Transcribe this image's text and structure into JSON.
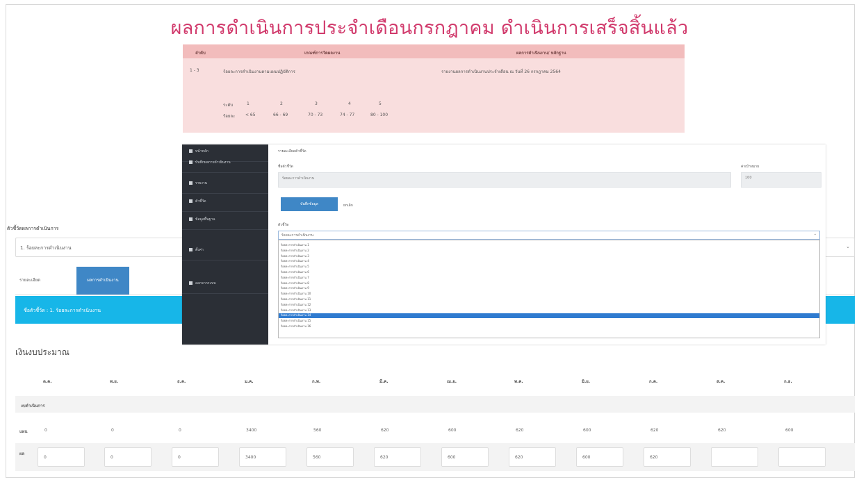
{
  "page_title": "ผลการดำเนินการประจำเดือนกรกฎาคม ดำเนินการเสร็จสิ้นแล้ว",
  "criteria_table": {
    "headers": [
      "ลำดับ",
      "เกณฑ์การวัดผลงาน",
      "ผลการดำเนินงาน/ หลักฐาน"
    ],
    "row_no": "1 - 3",
    "row_text": "ร้อยละการดำเนินงานตามแผนปฏิบัติการ",
    "scale_label": "ระดับ",
    "scale_levels": [
      "1",
      "2",
      "3",
      "4",
      "5"
    ],
    "score_label": "ร้อยละ",
    "score_ranges": [
      "< 65",
      "66 - 69",
      "70 - 73",
      "74 - 77",
      "80 - 100"
    ],
    "evidence": "รายงานผลการดำเนินงานประจำเดือน ณ วันที่ 26 กรกฎาคม 2564"
  },
  "inset": {
    "sidebar_items": [
      "หน้าหลัก",
      "บันทึกผลการดำเนินงาน",
      "รายงาน",
      "ตัวชี้วัด",
      "ข้อมูลพื้นฐาน",
      "ตั้งค่า",
      "ออกจากระบบ"
    ],
    "form_title": "รายละเอียดตัวชี้วัด",
    "field_name_label": "ชื่อตัวชี้วัด",
    "field_name_value": "ร้อยละการดำเนินงาน",
    "field_unit_label": "ค่าเป้าหมาย",
    "field_unit_value": "100",
    "btn_primary": "บันทึกข้อมูล",
    "btn_secondary": "ยกเลิก",
    "select_label": "ตัวชี้วัด",
    "select_value": "ร้อยละการดำเนินงาน",
    "options": [
      "ร้อยละการดำเนินงาน 1",
      "ร้อยละการดำเนินงาน 2",
      "ร้อยละการดำเนินงาน 3",
      "ร้อยละการดำเนินงาน 4",
      "ร้อยละการดำเนินงาน 5",
      "ร้อยละการดำเนินงาน 6",
      "ร้อยละการดำเนินงาน 7",
      "ร้อยละการดำเนินงาน 8",
      "ร้อยละการดำเนินงาน 9",
      "ร้อยละการดำเนินงาน 10",
      "ร้อยละการดำเนินงาน 11",
      "ร้อยละการดำเนินงาน 12",
      "ร้อยละการดำเนินงาน 13",
      "ร้อยละการดำเนินงาน 14",
      "ร้อยละการดำเนินงาน 15",
      "ร้อยละการดำเนินงาน 16"
    ],
    "highlighted_index": 13
  },
  "background": {
    "section_label": "ตัวชี้วัดผลการดำเนินการ",
    "select_value": "1. ร้อยละการดำเนินงาน",
    "tabs": [
      "รายละเอียด",
      "ผลการดำเนินงาน"
    ],
    "banner_text": "ชื่อตัวชี้วัด : 1. ร้อยละการดำเนินงาน",
    "subheading": "เงินงบประมาณ",
    "months": [
      "ต.ค.",
      "พ.ย.",
      "ธ.ค.",
      "ม.ค.",
      "ก.พ.",
      "มี.ค.",
      "เม.ย.",
      "พ.ค.",
      "มิ.ย.",
      "ก.ค.",
      "ส.ค.",
      "ก.ย."
    ],
    "group_label": "งบดำเนินการ",
    "row1_label": "แผน",
    "row1_values": [
      "0",
      "0",
      "0",
      "3400",
      "560",
      "620",
      "600",
      "620",
      "600",
      "620",
      "620",
      "600"
    ],
    "row2_label": "ผล",
    "row2_values": [
      "0",
      "0",
      "0",
      "3400",
      "560",
      "620",
      "600",
      "620",
      "600",
      "620",
      "",
      ""
    ]
  }
}
